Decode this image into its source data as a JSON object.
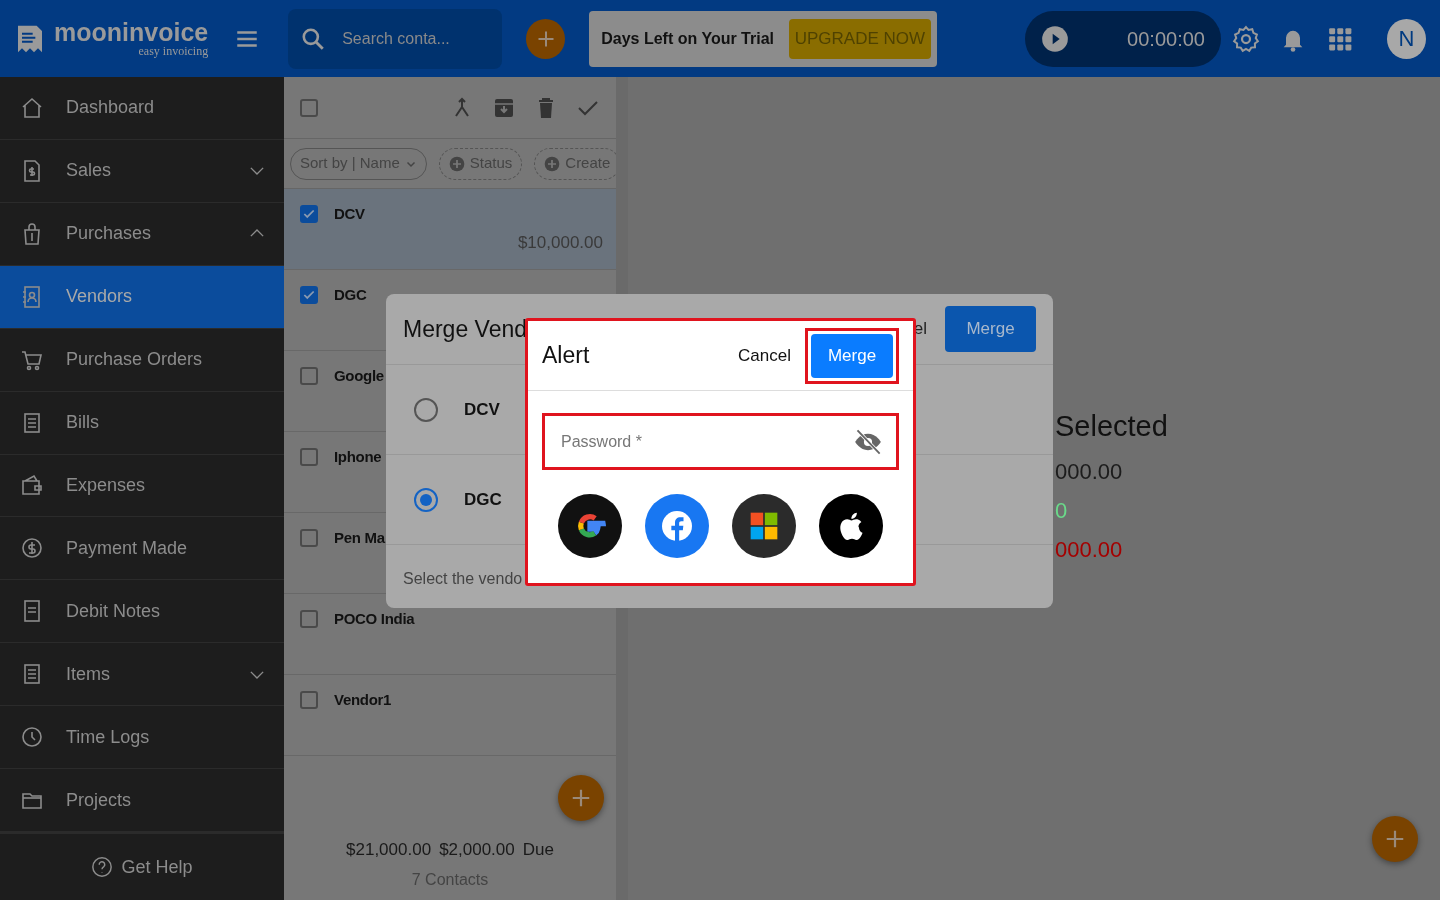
{
  "header": {
    "logo": {
      "name": "mooninvoice",
      "tagline": "easy invoicing"
    },
    "search": {
      "placeholder": "Search conta..."
    },
    "trial": {
      "text": "Days Left on Your Trial",
      "button": "UPGRADE NOW"
    },
    "timer": "00:00:00",
    "avatar": "N"
  },
  "sidebar": {
    "items": [
      {
        "label": "Dashboard",
        "kind": "link",
        "selected": false
      },
      {
        "label": "Sales",
        "kind": "group",
        "expanded": false,
        "selected": false
      },
      {
        "label": "Purchases",
        "kind": "group",
        "expanded": true,
        "selected": false
      },
      {
        "label": "Vendors",
        "kind": "link",
        "selected": true
      },
      {
        "label": "Purchase Orders",
        "kind": "link",
        "selected": false
      },
      {
        "label": "Bills",
        "kind": "link",
        "selected": false
      },
      {
        "label": "Expenses",
        "kind": "link",
        "selected": false
      },
      {
        "label": "Payment Made",
        "kind": "link",
        "selected": false
      },
      {
        "label": "Debit Notes",
        "kind": "link",
        "selected": false
      },
      {
        "label": "Items",
        "kind": "group",
        "expanded": false,
        "selected": false
      },
      {
        "label": "Time Logs",
        "kind": "link",
        "selected": false
      },
      {
        "label": "Projects",
        "kind": "link",
        "selected": false
      }
    ],
    "help": "Get Help"
  },
  "list": {
    "select_all": {
      "checked": false
    },
    "filters": [
      {
        "label": "Sort by | Name",
        "kind": "sort"
      },
      {
        "label": "Status",
        "kind": "add"
      },
      {
        "label": "Create",
        "kind": "add"
      }
    ],
    "vendors": [
      {
        "name": "DCV",
        "checked": true,
        "selected": true,
        "amount": "$10,000.00"
      },
      {
        "name": "DGC",
        "checked": true,
        "selected": false
      },
      {
        "name": "Google",
        "checked": false,
        "selected": false
      },
      {
        "name": "Iphone",
        "checked": false,
        "selected": false
      },
      {
        "name": "Pen Ma",
        "checked": false,
        "selected": false
      },
      {
        "name": "POCO India",
        "checked": false,
        "selected": false
      },
      {
        "name": "Vendor1",
        "checked": false,
        "selected": false
      }
    ],
    "totals": {
      "total": "$21,000.00",
      "due": "$2,000.00",
      "due_label": "Due",
      "count": "7 Contacts"
    }
  },
  "summary": {
    "title": "Selected",
    "values": [
      {
        "text": "000.00",
        "color": "#1c1c1c"
      },
      {
        "text": "0",
        "color": "#6bd98a"
      },
      {
        "text": "000.00",
        "color": "#a40000"
      }
    ]
  },
  "merge_dialog": {
    "title": "Merge Vend",
    "cancel": "el",
    "button": "Merge",
    "options": [
      {
        "name": "DCV",
        "selected": false
      },
      {
        "name": "DGC",
        "selected": true
      }
    ],
    "note": "Select the vendo"
  },
  "alert": {
    "title": "Alert",
    "cancel": "Cancel",
    "confirm": "Merge",
    "password": {
      "placeholder": "Password *"
    }
  }
}
